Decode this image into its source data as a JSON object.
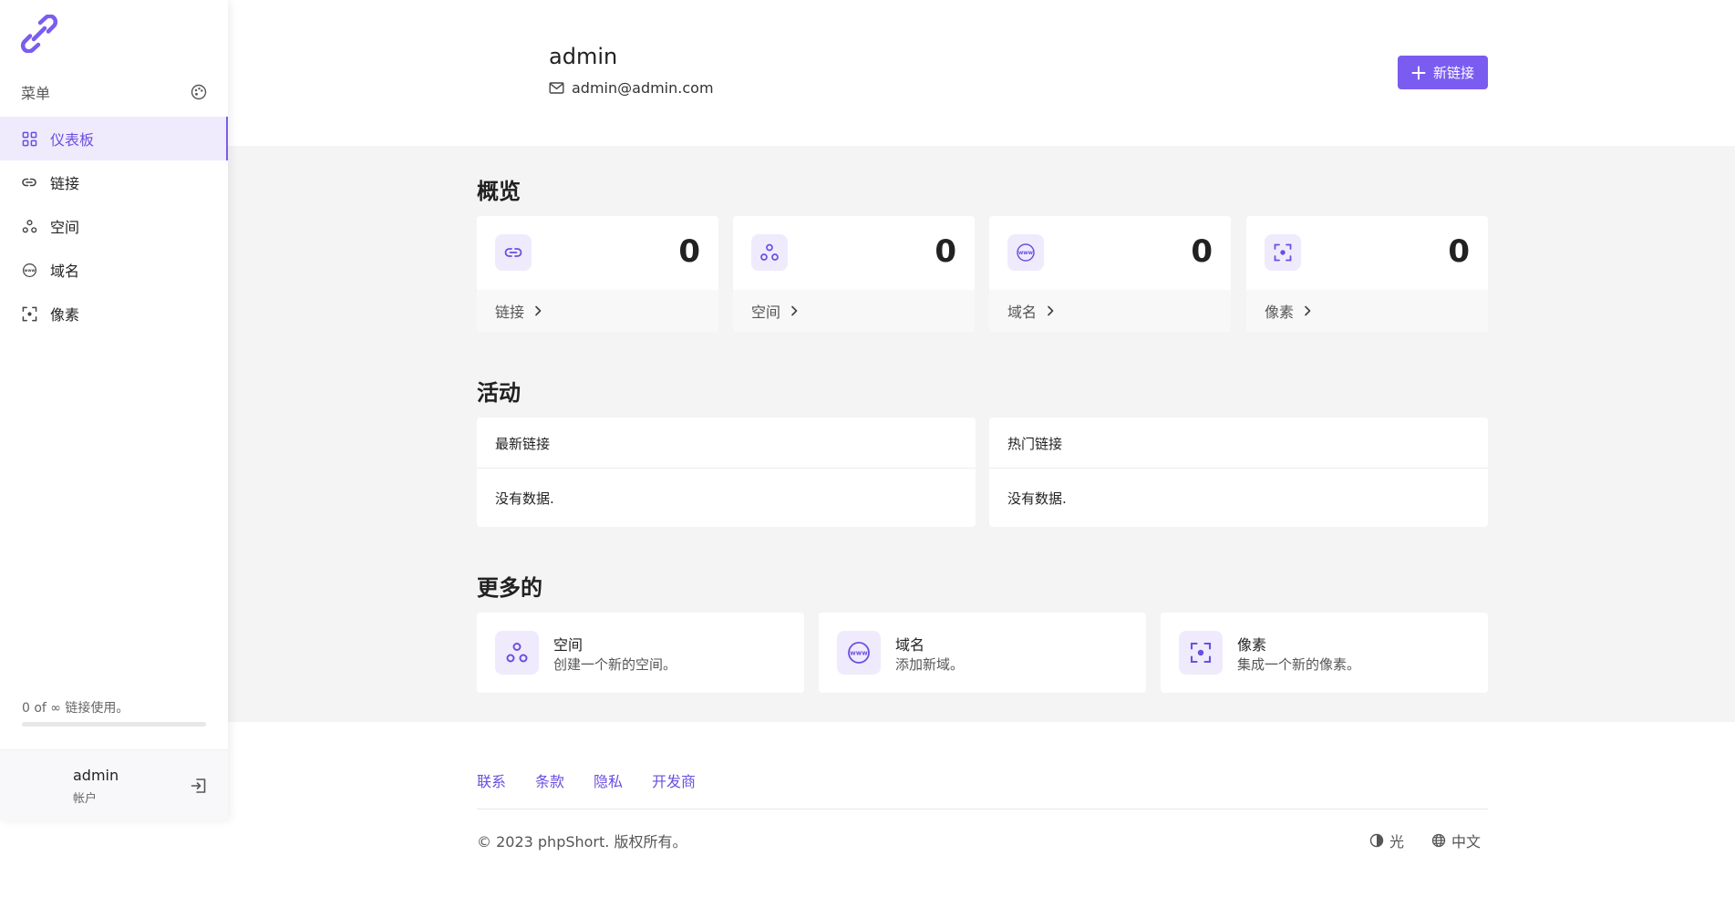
{
  "sidebar": {
    "menu_label": "菜单",
    "nav": [
      {
        "label": "仪表板",
        "icon": "dashboard-icon",
        "active": true
      },
      {
        "label": "链接",
        "icon": "link-icon",
        "active": false
      },
      {
        "label": "空间",
        "icon": "spaces-icon",
        "active": false
      },
      {
        "label": "域名",
        "icon": "domain-icon",
        "active": false
      },
      {
        "label": "像素",
        "icon": "pixel-icon",
        "active": false
      }
    ],
    "usage_text": "0 of ∞ 链接使用。",
    "usage_fraction": 0,
    "account": {
      "name": "admin",
      "role": "帐户"
    }
  },
  "header": {
    "user_name": "admin",
    "user_email": "admin@admin.com",
    "new_link_label": "新链接"
  },
  "overview": {
    "title": "概览",
    "cards": [
      {
        "label": "链接",
        "value": "0",
        "icon": "link-icon"
      },
      {
        "label": "空间",
        "value": "0",
        "icon": "spaces-icon"
      },
      {
        "label": "域名",
        "value": "0",
        "icon": "domain-icon"
      },
      {
        "label": "像素",
        "value": "0",
        "icon": "pixel-icon"
      }
    ]
  },
  "activity": {
    "title": "活动",
    "cards": [
      {
        "title": "最新链接",
        "empty": "没有数据."
      },
      {
        "title": "热门链接",
        "empty": "没有数据."
      }
    ]
  },
  "more": {
    "title": "更多的",
    "cards": [
      {
        "title": "空间",
        "desc": "创建一个新的空间。",
        "icon": "spaces-icon"
      },
      {
        "title": "域名",
        "desc": "添加新域。",
        "icon": "domain-icon"
      },
      {
        "title": "像素",
        "desc": "集成一个新的像素。",
        "icon": "pixel-icon"
      }
    ]
  },
  "footer": {
    "links": [
      "联系",
      "条款",
      "隐私",
      "开发商"
    ],
    "copyright": "© 2023 phpShort. 版权所有。",
    "theme_label": "光",
    "language_label": "中文"
  },
  "colors": {
    "accent": "#7b5cf0",
    "accent_light": "#efebfd",
    "band": "#f4f4f4"
  }
}
